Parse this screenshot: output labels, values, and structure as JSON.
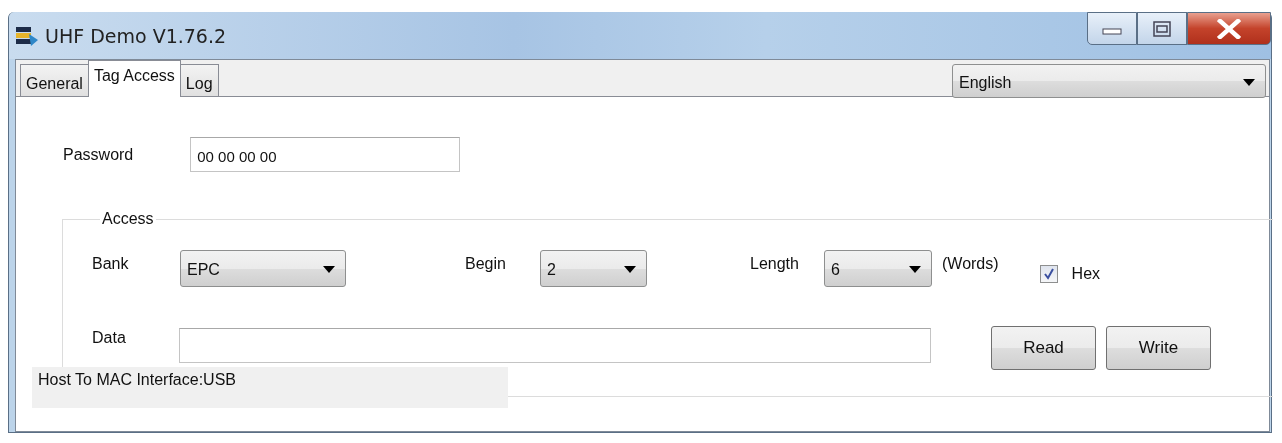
{
  "window": {
    "title": "UHF Demo V1.76.2"
  },
  "tabs": [
    {
      "label": "General",
      "selected": false
    },
    {
      "label": "Tag Access",
      "selected": true
    },
    {
      "label": "Log",
      "selected": false
    }
  ],
  "language": {
    "value": "English"
  },
  "password": {
    "label": "Password",
    "value": "00 00 00 00"
  },
  "access": {
    "title": "Access",
    "bank": {
      "label": "Bank",
      "value": "EPC"
    },
    "begin": {
      "label": "Begin",
      "value": "2"
    },
    "length": {
      "label": "Length",
      "value": "6",
      "unit": "(Words)"
    },
    "hex": {
      "label": "Hex",
      "checked": true
    },
    "data": {
      "label": "Data"
    },
    "buttons": [
      {
        "label": "Read"
      },
      {
        "label": "Write"
      }
    ]
  },
  "status_bar": {
    "text": "Host To MAC Interface:USB"
  }
}
